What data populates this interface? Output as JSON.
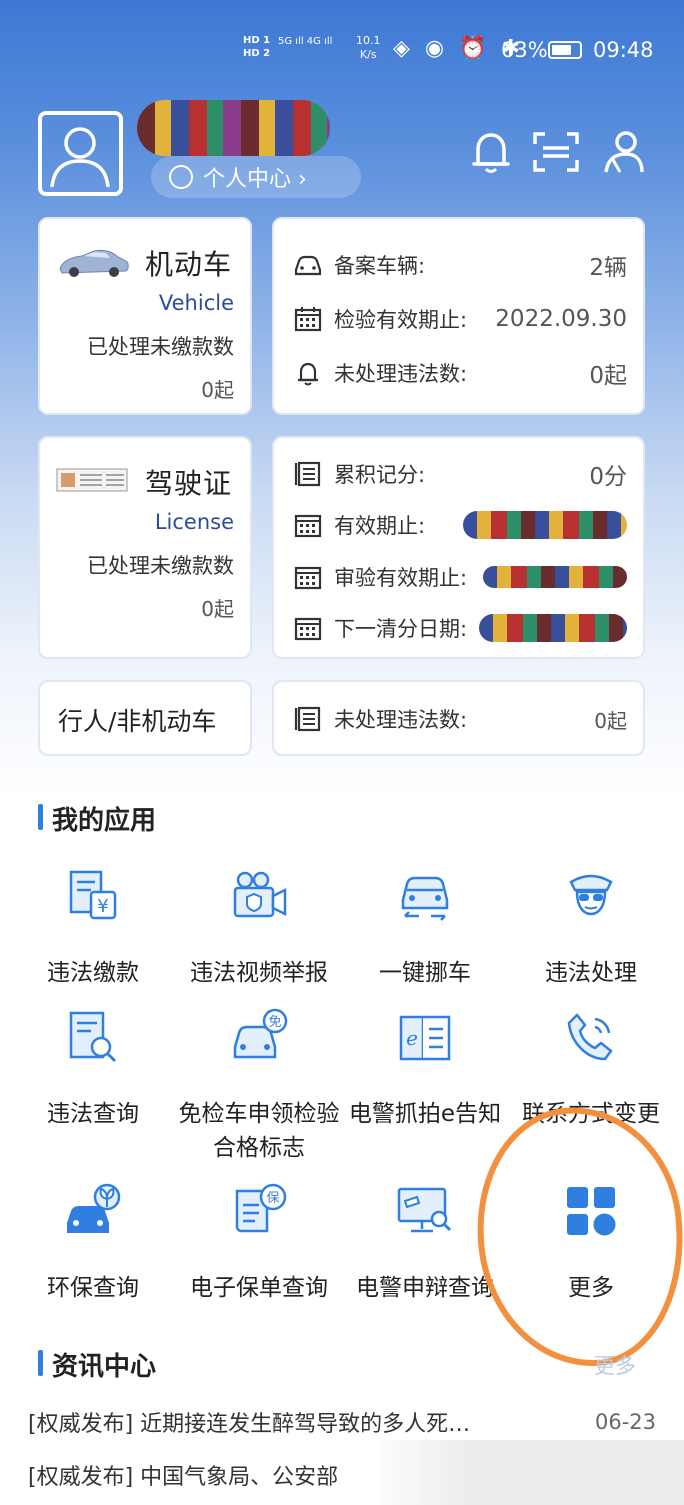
{
  "status_bar": {
    "hd1": "HD 1",
    "hd2": "HD 2",
    "network": "5G ıll 4G ıll",
    "speed_value": "10.1",
    "speed_unit": "K/s",
    "battery": "63%",
    "time": "09:48"
  },
  "header": {
    "personal_center": "个人中心 ›"
  },
  "vehicle_card": {
    "title": "机动车",
    "subtitle_en": "Vehicle",
    "pending_label": "已处理未缴款数",
    "pending_value": "0起"
  },
  "vehicle_info": [
    {
      "label": "备案车辆:",
      "value": "2辆"
    },
    {
      "label": "检验有效期止:",
      "value": "2022.09.30"
    },
    {
      "label": "未处理违法数:",
      "value": "0起"
    }
  ],
  "license_card": {
    "title": "驾驶证",
    "subtitle_en": "License",
    "pending_label": "已处理未缴款数",
    "pending_value": "0起"
  },
  "license_info": [
    {
      "label": "累积记分:",
      "value": "0分"
    },
    {
      "label": "有效期止:",
      "value": ""
    },
    {
      "label": "审验有效期止:",
      "value": ""
    },
    {
      "label": "下一清分日期:",
      "value": ""
    }
  ],
  "pedestrian": {
    "title": "行人/非机动车",
    "label": "未处理违法数:",
    "value": "0起"
  },
  "my_apps": {
    "title": "我的应用",
    "items": [
      {
        "label": "违法缴款",
        "icon": "payment-doc-icon"
      },
      {
        "label": "违法视频举报",
        "icon": "video-camera-icon"
      },
      {
        "label": "一键挪车",
        "icon": "move-car-icon"
      },
      {
        "label": "违法处理",
        "icon": "police-icon"
      },
      {
        "label": "违法查询",
        "icon": "doc-search-icon"
      },
      {
        "label": "免检车申领检验合格标志",
        "icon": "exempt-car-icon"
      },
      {
        "label": "电警抓拍e告知",
        "icon": "e-book-icon"
      },
      {
        "label": "联系方式变更",
        "icon": "phone-icon"
      },
      {
        "label": "环保查询",
        "icon": "eco-car-icon"
      },
      {
        "label": "电子保单查询",
        "icon": "insurance-doc-icon"
      },
      {
        "label": "电警申辩查询",
        "icon": "monitor-search-icon"
      },
      {
        "label": "更多",
        "icon": "grid-more-icon"
      }
    ]
  },
  "news": {
    "title": "资讯中心",
    "more": "更多",
    "items": [
      {
        "title": "[权威发布] 近期接连发生醉驾导致的多人死…",
        "date": "06-23"
      },
      {
        "title": "[权威发布] 中国气象局、公安部",
        "date": ""
      }
    ]
  },
  "colors": {
    "accent": "#2f7fe0",
    "annotation": "#f3903d"
  }
}
